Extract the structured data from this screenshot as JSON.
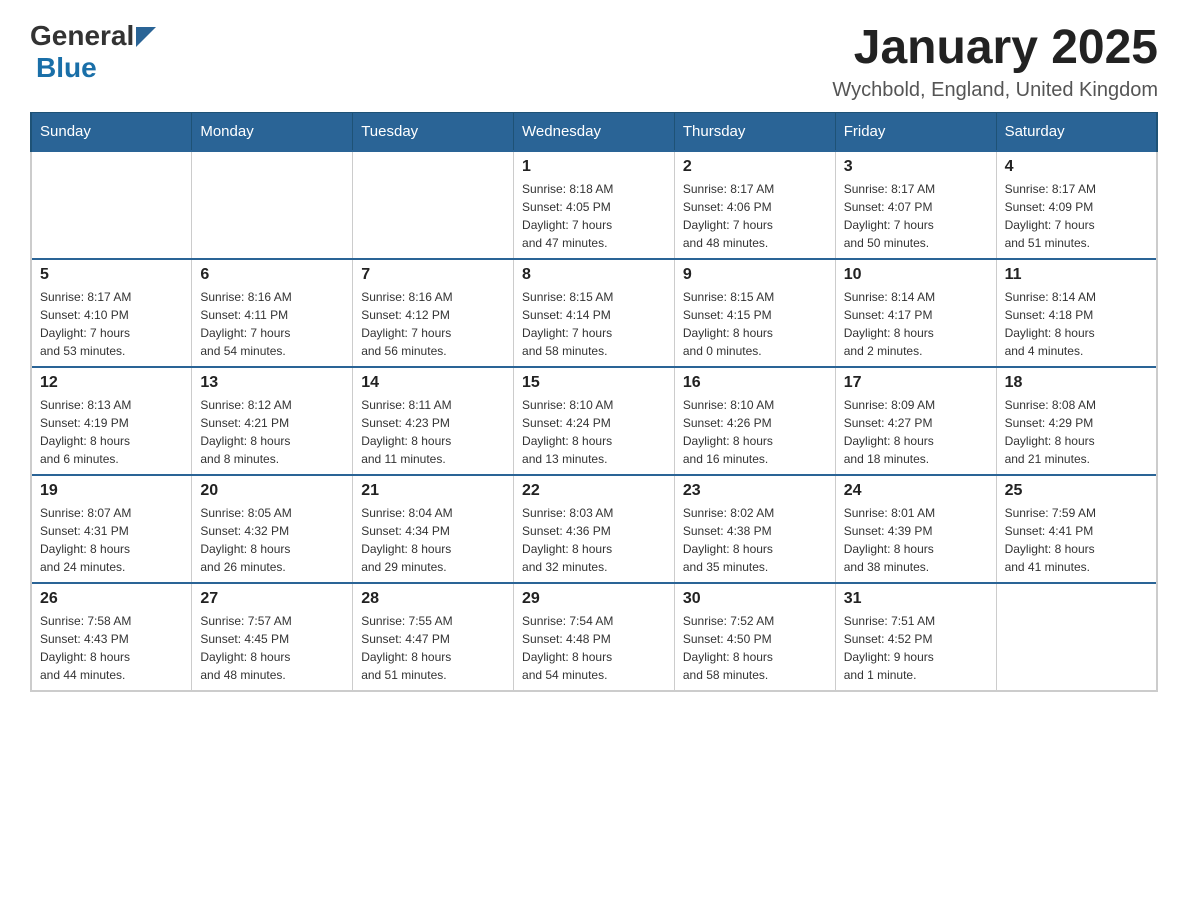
{
  "header": {
    "logo_general": "General",
    "logo_blue": "Blue",
    "title": "January 2025",
    "location": "Wychbold, England, United Kingdom"
  },
  "days_of_week": [
    "Sunday",
    "Monday",
    "Tuesday",
    "Wednesday",
    "Thursday",
    "Friday",
    "Saturday"
  ],
  "weeks": [
    [
      {
        "day": "",
        "info": ""
      },
      {
        "day": "",
        "info": ""
      },
      {
        "day": "",
        "info": ""
      },
      {
        "day": "1",
        "info": "Sunrise: 8:18 AM\nSunset: 4:05 PM\nDaylight: 7 hours\nand 47 minutes."
      },
      {
        "day": "2",
        "info": "Sunrise: 8:17 AM\nSunset: 4:06 PM\nDaylight: 7 hours\nand 48 minutes."
      },
      {
        "day": "3",
        "info": "Sunrise: 8:17 AM\nSunset: 4:07 PM\nDaylight: 7 hours\nand 50 minutes."
      },
      {
        "day": "4",
        "info": "Sunrise: 8:17 AM\nSunset: 4:09 PM\nDaylight: 7 hours\nand 51 minutes."
      }
    ],
    [
      {
        "day": "5",
        "info": "Sunrise: 8:17 AM\nSunset: 4:10 PM\nDaylight: 7 hours\nand 53 minutes."
      },
      {
        "day": "6",
        "info": "Sunrise: 8:16 AM\nSunset: 4:11 PM\nDaylight: 7 hours\nand 54 minutes."
      },
      {
        "day": "7",
        "info": "Sunrise: 8:16 AM\nSunset: 4:12 PM\nDaylight: 7 hours\nand 56 minutes."
      },
      {
        "day": "8",
        "info": "Sunrise: 8:15 AM\nSunset: 4:14 PM\nDaylight: 7 hours\nand 58 minutes."
      },
      {
        "day": "9",
        "info": "Sunrise: 8:15 AM\nSunset: 4:15 PM\nDaylight: 8 hours\nand 0 minutes."
      },
      {
        "day": "10",
        "info": "Sunrise: 8:14 AM\nSunset: 4:17 PM\nDaylight: 8 hours\nand 2 minutes."
      },
      {
        "day": "11",
        "info": "Sunrise: 8:14 AM\nSunset: 4:18 PM\nDaylight: 8 hours\nand 4 minutes."
      }
    ],
    [
      {
        "day": "12",
        "info": "Sunrise: 8:13 AM\nSunset: 4:19 PM\nDaylight: 8 hours\nand 6 minutes."
      },
      {
        "day": "13",
        "info": "Sunrise: 8:12 AM\nSunset: 4:21 PM\nDaylight: 8 hours\nand 8 minutes."
      },
      {
        "day": "14",
        "info": "Sunrise: 8:11 AM\nSunset: 4:23 PM\nDaylight: 8 hours\nand 11 minutes."
      },
      {
        "day": "15",
        "info": "Sunrise: 8:10 AM\nSunset: 4:24 PM\nDaylight: 8 hours\nand 13 minutes."
      },
      {
        "day": "16",
        "info": "Sunrise: 8:10 AM\nSunset: 4:26 PM\nDaylight: 8 hours\nand 16 minutes."
      },
      {
        "day": "17",
        "info": "Sunrise: 8:09 AM\nSunset: 4:27 PM\nDaylight: 8 hours\nand 18 minutes."
      },
      {
        "day": "18",
        "info": "Sunrise: 8:08 AM\nSunset: 4:29 PM\nDaylight: 8 hours\nand 21 minutes."
      }
    ],
    [
      {
        "day": "19",
        "info": "Sunrise: 8:07 AM\nSunset: 4:31 PM\nDaylight: 8 hours\nand 24 minutes."
      },
      {
        "day": "20",
        "info": "Sunrise: 8:05 AM\nSunset: 4:32 PM\nDaylight: 8 hours\nand 26 minutes."
      },
      {
        "day": "21",
        "info": "Sunrise: 8:04 AM\nSunset: 4:34 PM\nDaylight: 8 hours\nand 29 minutes."
      },
      {
        "day": "22",
        "info": "Sunrise: 8:03 AM\nSunset: 4:36 PM\nDaylight: 8 hours\nand 32 minutes."
      },
      {
        "day": "23",
        "info": "Sunrise: 8:02 AM\nSunset: 4:38 PM\nDaylight: 8 hours\nand 35 minutes."
      },
      {
        "day": "24",
        "info": "Sunrise: 8:01 AM\nSunset: 4:39 PM\nDaylight: 8 hours\nand 38 minutes."
      },
      {
        "day": "25",
        "info": "Sunrise: 7:59 AM\nSunset: 4:41 PM\nDaylight: 8 hours\nand 41 minutes."
      }
    ],
    [
      {
        "day": "26",
        "info": "Sunrise: 7:58 AM\nSunset: 4:43 PM\nDaylight: 8 hours\nand 44 minutes."
      },
      {
        "day": "27",
        "info": "Sunrise: 7:57 AM\nSunset: 4:45 PM\nDaylight: 8 hours\nand 48 minutes."
      },
      {
        "day": "28",
        "info": "Sunrise: 7:55 AM\nSunset: 4:47 PM\nDaylight: 8 hours\nand 51 minutes."
      },
      {
        "day": "29",
        "info": "Sunrise: 7:54 AM\nSunset: 4:48 PM\nDaylight: 8 hours\nand 54 minutes."
      },
      {
        "day": "30",
        "info": "Sunrise: 7:52 AM\nSunset: 4:50 PM\nDaylight: 8 hours\nand 58 minutes."
      },
      {
        "day": "31",
        "info": "Sunrise: 7:51 AM\nSunset: 4:52 PM\nDaylight: 9 hours\nand 1 minute."
      },
      {
        "day": "",
        "info": ""
      }
    ]
  ]
}
